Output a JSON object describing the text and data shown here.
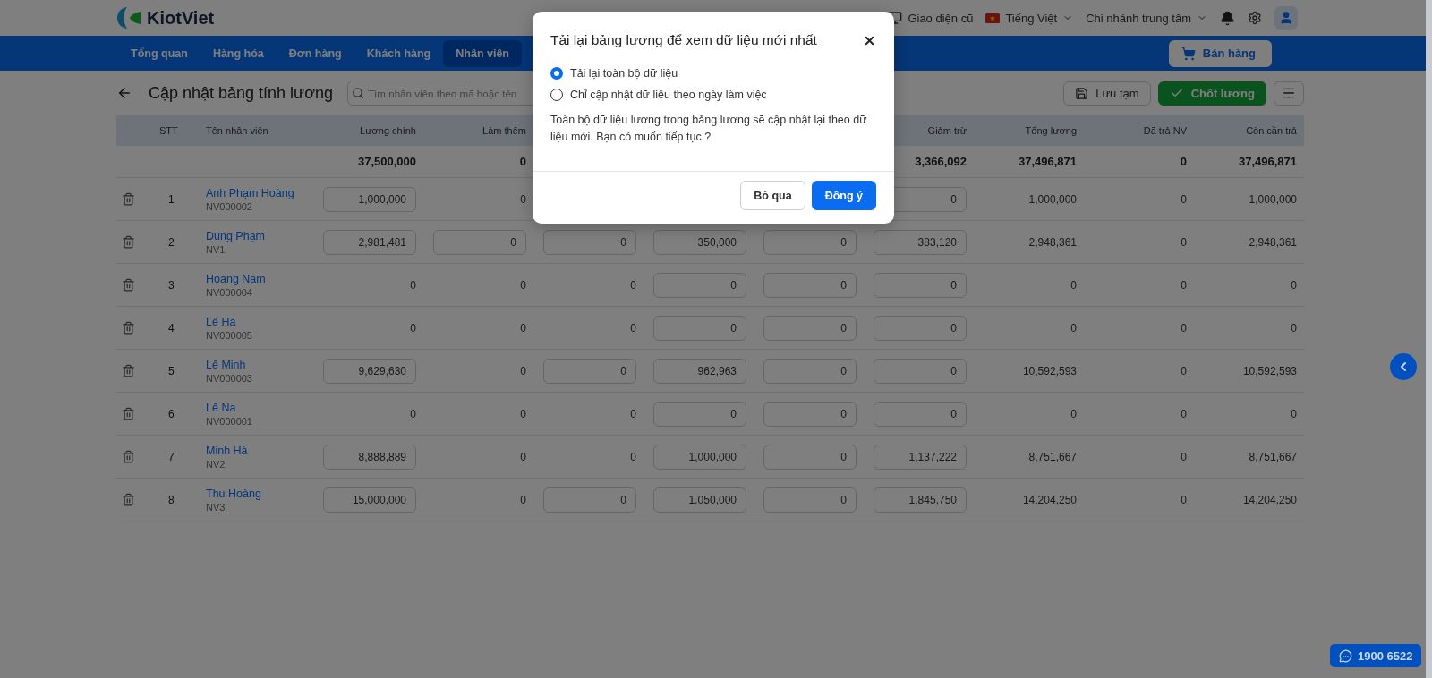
{
  "header": {
    "logo_text": "KiotViet",
    "old_ui": "Giao diện cũ",
    "language": "Tiếng Việt",
    "branch": "Chi nhánh trung tâm"
  },
  "nav": {
    "items": [
      {
        "label": "Tổng quan",
        "selected": false
      },
      {
        "label": "Hàng hóa",
        "selected": false
      },
      {
        "label": "Đơn hàng",
        "selected": false
      },
      {
        "label": "Khách hàng",
        "selected": false
      },
      {
        "label": "Nhân viên",
        "selected": true
      }
    ],
    "sell_button": "Bán hàng"
  },
  "toolbar": {
    "title": "Cập nhật bảng tính lương",
    "search": {
      "placeholder": "Tìm nhân viên theo mã hoặc tên"
    },
    "buttons": [
      {
        "label": "Lưu tạm",
        "kind": "save"
      },
      {
        "label": "Chốt lương",
        "kind": "confirm"
      },
      {
        "kind": "menu"
      }
    ]
  },
  "table": {
    "stt_header": "STT",
    "name_header": "Tên nhân viên",
    "columns": [
      {
        "kind": "header",
        "label": "Lương chính"
      },
      {
        "kind": "header",
        "label": "Làm thêm"
      },
      {
        "kind": "hidden"
      },
      {
        "kind": "hidden"
      },
      {
        "kind": "hidden"
      },
      {
        "kind": "header",
        "label": "Giảm trừ"
      },
      {
        "kind": "header",
        "label": "Tổng lương"
      },
      {
        "kind": "header",
        "label": "Đã trả NV"
      },
      {
        "kind": "header",
        "label": "Còn cần trả"
      }
    ],
    "totals": [
      {
        "kind": "text",
        "value": "37,500,000"
      },
      {
        "kind": "text",
        "value": "0"
      },
      {
        "kind": "hidden"
      },
      {
        "kind": "hidden"
      },
      {
        "kind": "hidden"
      },
      {
        "kind": "text",
        "value": "3,366,092"
      },
      {
        "kind": "text",
        "value": "37,496,871"
      },
      {
        "kind": "text",
        "value": "0"
      },
      {
        "kind": "text",
        "value": "37,496,871"
      }
    ],
    "rows": [
      {
        "stt": "1",
        "name": "Anh Phạm Hoàng",
        "code": "NV000002",
        "cells": [
          {
            "value": "1,000,000",
            "kind": "input"
          },
          {
            "value": "0",
            "kind": "text"
          },
          {
            "kind": "hidden"
          },
          {
            "kind": "hidden"
          },
          {
            "kind": "hidden"
          },
          {
            "value": "0",
            "kind": "input"
          },
          {
            "value": "1,000,000",
            "kind": "text"
          },
          {
            "value": "0",
            "kind": "text"
          },
          {
            "value": "1,000,000",
            "kind": "text"
          }
        ]
      },
      {
        "stt": "2",
        "name": "Dung Phạm",
        "code": "NV1",
        "cells": [
          {
            "value": "2,981,481",
            "kind": "input"
          },
          {
            "value": "0",
            "kind": "input"
          },
          {
            "value": "0",
            "kind": "input"
          },
          {
            "value": "350,000",
            "kind": "input"
          },
          {
            "value": "0",
            "kind": "input"
          },
          {
            "value": "383,120",
            "kind": "input"
          },
          {
            "value": "2,948,361",
            "kind": "text"
          },
          {
            "value": "0",
            "kind": "text"
          },
          {
            "value": "2,948,361",
            "kind": "text"
          }
        ]
      },
      {
        "stt": "3",
        "name": "Hoàng Nam",
        "code": "NV000004",
        "cells": [
          {
            "value": "0",
            "kind": "text"
          },
          {
            "value": "0",
            "kind": "text"
          },
          {
            "value": "0",
            "kind": "text"
          },
          {
            "value": "0",
            "kind": "input"
          },
          {
            "value": "0",
            "kind": "input"
          },
          {
            "value": "0",
            "kind": "input"
          },
          {
            "value": "0",
            "kind": "text"
          },
          {
            "value": "0",
            "kind": "text"
          },
          {
            "value": "0",
            "kind": "text"
          }
        ]
      },
      {
        "stt": "4",
        "name": "Lê Hà",
        "code": "NV000005",
        "cells": [
          {
            "value": "0",
            "kind": "text"
          },
          {
            "value": "0",
            "kind": "text"
          },
          {
            "value": "0",
            "kind": "text"
          },
          {
            "value": "0",
            "kind": "input"
          },
          {
            "value": "0",
            "kind": "input"
          },
          {
            "value": "0",
            "kind": "input"
          },
          {
            "value": "0",
            "kind": "text"
          },
          {
            "value": "0",
            "kind": "text"
          },
          {
            "value": "0",
            "kind": "text"
          }
        ]
      },
      {
        "stt": "5",
        "name": "Lê Minh",
        "code": "NV000003",
        "cells": [
          {
            "value": "9,629,630",
            "kind": "input"
          },
          {
            "value": "0",
            "kind": "text"
          },
          {
            "value": "0",
            "kind": "input"
          },
          {
            "value": "962,963",
            "kind": "input"
          },
          {
            "value": "0",
            "kind": "input"
          },
          {
            "value": "0",
            "kind": "input"
          },
          {
            "value": "10,592,593",
            "kind": "text"
          },
          {
            "value": "0",
            "kind": "text"
          },
          {
            "value": "10,592,593",
            "kind": "text"
          }
        ]
      },
      {
        "stt": "6",
        "name": "Lê Na",
        "code": "NV000001",
        "cells": [
          {
            "value": "0",
            "kind": "text"
          },
          {
            "value": "0",
            "kind": "text"
          },
          {
            "value": "0",
            "kind": "text"
          },
          {
            "value": "0",
            "kind": "input"
          },
          {
            "value": "0",
            "kind": "input"
          },
          {
            "value": "0",
            "kind": "input"
          },
          {
            "value": "0",
            "kind": "text"
          },
          {
            "value": "0",
            "kind": "text"
          },
          {
            "value": "0",
            "kind": "text"
          }
        ]
      },
      {
        "stt": "7",
        "name": "Minh Hà",
        "code": "NV2",
        "cells": [
          {
            "value": "8,888,889",
            "kind": "input"
          },
          {
            "value": "0",
            "kind": "text"
          },
          {
            "value": "0",
            "kind": "text"
          },
          {
            "value": "1,000,000",
            "kind": "input"
          },
          {
            "value": "0",
            "kind": "input"
          },
          {
            "value": "1,137,222",
            "kind": "input"
          },
          {
            "value": "8,751,667",
            "kind": "text"
          },
          {
            "value": "0",
            "kind": "text"
          },
          {
            "value": "8,751,667",
            "kind": "text"
          }
        ]
      },
      {
        "stt": "8",
        "name": "Thu Hoàng",
        "code": "NV3",
        "cells": [
          {
            "value": "15,000,000",
            "kind": "input"
          },
          {
            "value": "0",
            "kind": "text"
          },
          {
            "value": "0",
            "kind": "input"
          },
          {
            "value": "1,050,000",
            "kind": "input"
          },
          {
            "value": "0",
            "kind": "input"
          },
          {
            "value": "1,845,750",
            "kind": "input"
          },
          {
            "value": "14,204,250",
            "kind": "text"
          },
          {
            "value": "0",
            "kind": "text"
          },
          {
            "value": "14,204,250",
            "kind": "text"
          }
        ]
      }
    ]
  },
  "dialog": {
    "title": "Tải lại bảng lương để xem dữ liệu mới nhất",
    "options": [
      {
        "label": "Tải lại toàn bộ dữ liệu",
        "selected": true
      },
      {
        "label": "Chỉ cập nhật dữ liệu theo ngày làm việc",
        "selected": false
      }
    ],
    "message": "Toàn bộ dữ liệu lương trong bảng lương sẽ cập nhật lại theo dữ liệu mới. Bạn có muốn tiếp tục ?",
    "buttons": [
      {
        "label": "Bỏ qua",
        "kind": "secondary"
      },
      {
        "label": "Đồng ý",
        "kind": "primary"
      }
    ]
  },
  "hotline": {
    "label": "1900 6522"
  }
}
